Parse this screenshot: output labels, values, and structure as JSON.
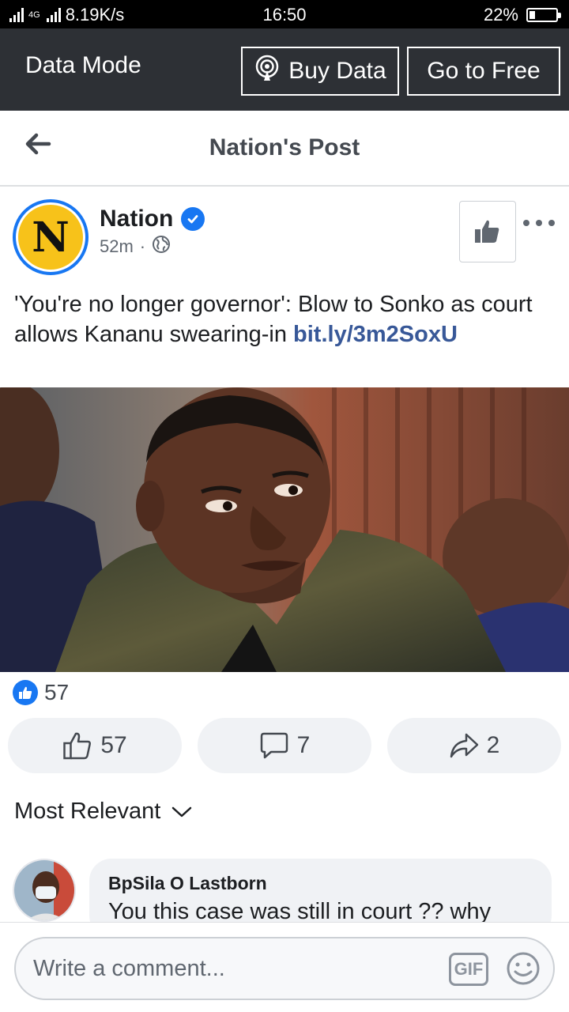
{
  "status_bar": {
    "network_type": "4G",
    "net_speed": "8.19K/s",
    "time": "16:50",
    "battery_percent": "22%",
    "battery_level": 0.22
  },
  "data_mode_bar": {
    "label": "Data Mode",
    "buy_data_label": "Buy Data",
    "go_free_label": "Go to Free"
  },
  "header": {
    "title": "Nation's Post"
  },
  "post": {
    "page_name": "Nation",
    "avatar_letter": "N",
    "time_ago": "52m",
    "separator": "·",
    "text": "'You're no longer governor': Blow to Sonko as court allows Kananu swearing-in ",
    "link": "bit.ly/3m2SoxU",
    "reaction_count": "57",
    "actions": {
      "like_count": "57",
      "comment_count": "7",
      "share_count": "2"
    }
  },
  "comments": {
    "sort_label": "Most Relevant",
    "items": [
      {
        "author": "BpSila O Lastborn",
        "text": "You this case was still in court ?? why"
      }
    ]
  },
  "composer": {
    "placeholder": "Write a comment...",
    "gif_label": "GIF"
  },
  "icons": {
    "back": "arrow-left-icon",
    "buy_data": "broadcast-icon",
    "verified": "verified-check-icon",
    "audience": "globe-icon",
    "like_page": "thumbs-up-icon",
    "more": "more-horizontal-icon",
    "like": "thumbs-up-outline-icon",
    "comment": "speech-bubble-icon",
    "share": "share-arrow-icon",
    "sort": "chevron-down-icon",
    "emoji": "smiley-icon"
  },
  "colors": {
    "brand_blue": "#1877f2",
    "link": "#385898",
    "data_bar": "#2d3035",
    "nation_yellow": "#f7c21a"
  }
}
